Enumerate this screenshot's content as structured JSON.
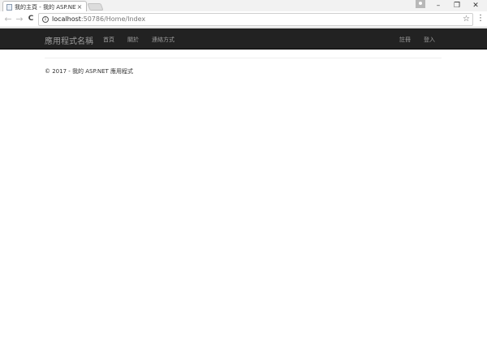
{
  "browser": {
    "tab": {
      "title": "我的主頁 - 我的 ASP.NET"
    },
    "address_bar": {
      "host": "localhost",
      "path": ":50786/Home/Index"
    },
    "icons": {
      "close": "×",
      "back": "←",
      "forward": "→",
      "reload": "C",
      "info": "i",
      "star": "☆",
      "menu": "⋮",
      "minimize": "–",
      "restore": "❐",
      "window_close": "✕"
    }
  },
  "navbar": {
    "brand": "應用程式名稱",
    "links": [
      "首頁",
      "關於",
      "連絡方式"
    ],
    "right_links": [
      "註冊",
      "登入"
    ]
  },
  "footer": {
    "text": "© 2017 - 我的 ASP.NET 應用程式"
  },
  "colors": {
    "navbar_bg": "#222222",
    "navbar_text": "#9d9d9d"
  }
}
